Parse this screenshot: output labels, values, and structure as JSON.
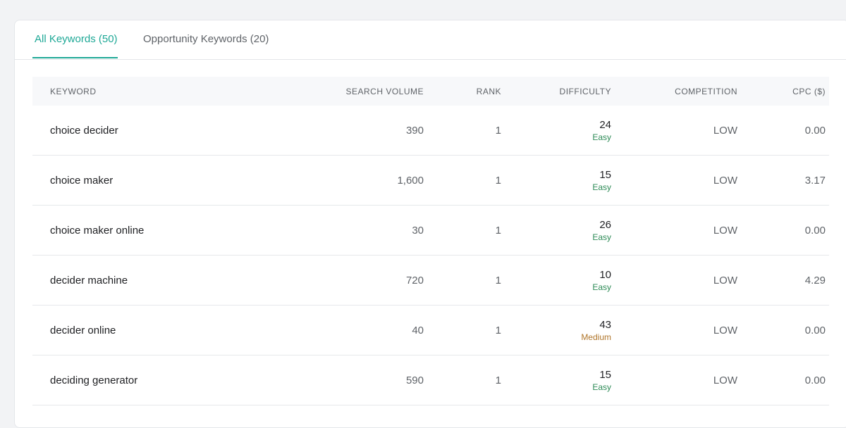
{
  "tabs": [
    {
      "label": "All Keywords (50)",
      "active": true
    },
    {
      "label": "Opportunity Keywords (20)",
      "active": false
    }
  ],
  "table": {
    "headers": {
      "keyword": "KEYWORD",
      "search_volume": "SEARCH VOLUME",
      "rank": "RANK",
      "difficulty": "DIFFICULTY",
      "competition": "COMPETITION",
      "cpc": "CPC ($)"
    },
    "rows": [
      {
        "keyword": "choice decider",
        "search_volume": "390",
        "rank": "1",
        "difficulty": "24",
        "difficulty_label": "Easy",
        "competition": "LOW",
        "cpc": "0.00"
      },
      {
        "keyword": "choice maker",
        "search_volume": "1,600",
        "rank": "1",
        "difficulty": "15",
        "difficulty_label": "Easy",
        "competition": "LOW",
        "cpc": "3.17"
      },
      {
        "keyword": "choice maker online",
        "search_volume": "30",
        "rank": "1",
        "difficulty": "26",
        "difficulty_label": "Easy",
        "competition": "LOW",
        "cpc": "0.00"
      },
      {
        "keyword": "decider machine",
        "search_volume": "720",
        "rank": "1",
        "difficulty": "10",
        "difficulty_label": "Easy",
        "competition": "LOW",
        "cpc": "4.29"
      },
      {
        "keyword": "decider online",
        "search_volume": "40",
        "rank": "1",
        "difficulty": "43",
        "difficulty_label": "Medium",
        "competition": "LOW",
        "cpc": "0.00"
      },
      {
        "keyword": "deciding generator",
        "search_volume": "590",
        "rank": "1",
        "difficulty": "15",
        "difficulty_label": "Easy",
        "competition": "LOW",
        "cpc": "0.00"
      }
    ]
  },
  "colors": {
    "accent": "#1ea896",
    "easy": "#2e8b57",
    "medium": "#b0762b"
  }
}
